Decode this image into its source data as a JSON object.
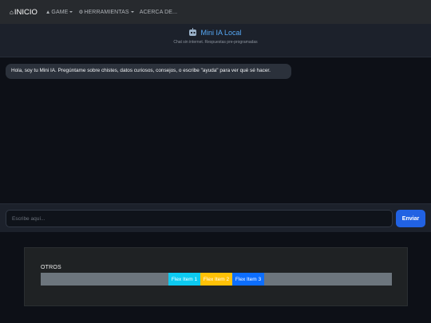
{
  "nav": {
    "brand": "INICIO",
    "items": [
      {
        "label": "GAME",
        "icon": "gamepad-icon",
        "dropdown": true
      },
      {
        "label": "HERRAMIENTAS",
        "icon": "gear-icon",
        "dropdown": true
      },
      {
        "label": "ACERCA DE...",
        "dropdown": false
      }
    ]
  },
  "chat": {
    "title": "Mini IA Local",
    "subtitle": "Chat sin internet. Respuestas pre-programadas",
    "messages": [
      {
        "from": "bot",
        "text": "Hola, soy tu Mini IA. Pregúntame sobre chistes, datos curiosos, consejos, o escribe \"ayuda\" para ver qué sé hacer."
      }
    ]
  },
  "input": {
    "placeholder": "Escribe aquí...",
    "value": "",
    "send_label": "Enviar"
  },
  "otros": {
    "label": "OTROS",
    "items": [
      "Flex Item 1",
      "Flex Item 2",
      "Flex Item 3"
    ]
  },
  "colors": {
    "accent": "#2162e3",
    "title": "#56a8f5",
    "item1": "#0dcaf0",
    "item2": "#ffc107",
    "item3": "#0d6efd"
  }
}
